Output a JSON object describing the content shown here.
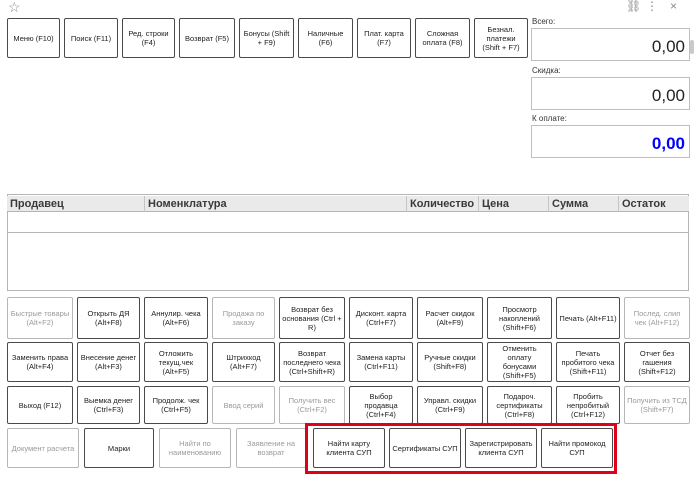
{
  "colors": {
    "accent_due": "#0000ff",
    "highlight": "#e0001a"
  },
  "topbar": {
    "star_icon": "☆",
    "link_icon": "⛓",
    "more_icon": "⋮",
    "close_icon": "×"
  },
  "toolbar": {
    "menu": "Меню (F10)",
    "search": "Поиск (F11)",
    "edit_line": "Ред. строки (F4)",
    "return": "Возврат (F5)",
    "bonuses": "Бонусы (Shift + F9)",
    "cash": "Наличные (F6)",
    "card": "Плат. карта (F7)",
    "complex_payment": "Сложная оплата (F8)",
    "noncash": "Безнал. платежи (Shift + F7)"
  },
  "totals": {
    "total_label": "Всего:",
    "total_value": "0,00",
    "discount_label": "Скидка:",
    "discount_value": "0,00",
    "due_label": "К оплате:",
    "due_value": "0,00"
  },
  "grid": {
    "columns": [
      "Продавец",
      "Номенклатура",
      "Количество",
      "Цена",
      "Сумма",
      "Остаток"
    ]
  },
  "buttons": {
    "row1": [
      "Быстрые товары (Alt+F2)",
      "Открыть ДЯ (Alt+F8)",
      "Аннулир. чека (Alt+F6)",
      "Продажа по заказу",
      "Возврат без основания (Ctrl + R)",
      "Дисконт. карта (Ctrl+F7)",
      "Расчет скидок (Alt+F9)",
      "Просмотр накоплений (Shift+F6)",
      "Печать (Alt+F11)",
      "Послед. слип чек (Alt+F12)"
    ],
    "row2": [
      "Заменить права (Alt+F4)",
      "Внесение денег (Alt+F3)",
      "Отложить текущ.чек (Alt+F5)",
      "Штрихкод (Alt+F7)",
      "Возврат последнего чека (Ctrl+Shift+R)",
      "Замена карты (Ctrl+F11)",
      "Ручные скидки (Shift+F8)",
      "Отменить оплату бонусами (Shift+F5)",
      "Печать пробитого чека (Shift+F11)",
      "Отчет без гашения (Shift+F12)"
    ],
    "row3": [
      "Выход (F12)",
      "Выемка денег (Ctrl+F3)",
      "Продолж. чек (Ctrl+F5)",
      "Ввод серий",
      "Получить вес (Ctrl+F2)",
      "Выбор продавца (Ctrl+F4)",
      "Управл. скидки (Ctrl+F9)",
      "Подароч. сертификаты (Ctrl+F8)",
      "Пробить непробитый (Ctrl+F12)",
      "Получить из ТСД (Shift+F7)"
    ],
    "row4": [
      "Документ расчета",
      "Марки",
      "Найти по наименованию",
      "Заявление на возврат",
      "Найти карту клиента СУП",
      "Сертификаты СУП",
      "Зарегистрировать клиента СУП",
      "Найти промокод СУП"
    ]
  }
}
